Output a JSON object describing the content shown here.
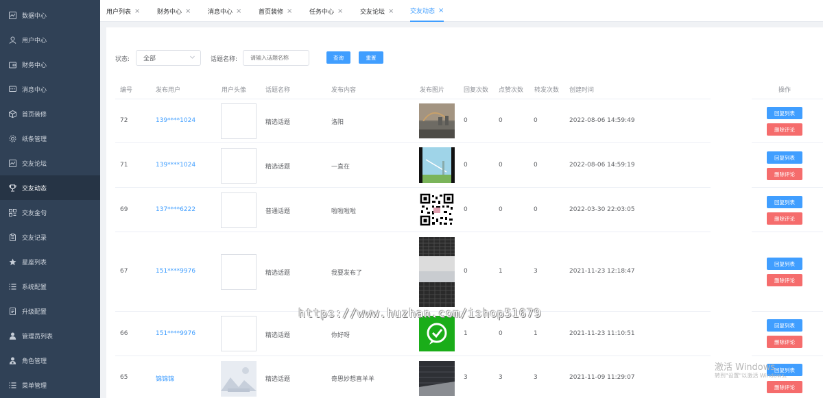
{
  "sidebar": {
    "items": [
      {
        "label": "数据中心",
        "icon": "chart-icon"
      },
      {
        "label": "用户中心",
        "icon": "user-icon"
      },
      {
        "label": "财务中心",
        "icon": "wallet-icon"
      },
      {
        "label": "消息中心",
        "icon": "message-icon"
      },
      {
        "label": "首页装修",
        "icon": "box-icon"
      },
      {
        "label": "纸条管理",
        "icon": "settings-icon"
      },
      {
        "label": "交友论坛",
        "icon": "chart-icon"
      },
      {
        "label": "交友动态",
        "icon": "trophy-icon"
      },
      {
        "label": "交友金句",
        "icon": "grid-icon"
      },
      {
        "label": "交友记录",
        "icon": "clipboard-icon"
      },
      {
        "label": "星座列表",
        "icon": "star-icon"
      },
      {
        "label": "系统配置",
        "icon": "list-icon"
      },
      {
        "label": "升级配置",
        "icon": "document-icon"
      },
      {
        "label": "管理员列表",
        "icon": "person-icon"
      },
      {
        "label": "角色管理",
        "icon": "person-badge-icon"
      },
      {
        "label": "菜单管理",
        "icon": "menu-icon"
      }
    ],
    "active_index": 7
  },
  "tabs": [
    {
      "label": "用户列表"
    },
    {
      "label": "财务中心"
    },
    {
      "label": "消息中心"
    },
    {
      "label": "首页装修"
    },
    {
      "label": "任务中心"
    },
    {
      "label": "交友论坛"
    },
    {
      "label": "交友动态"
    }
  ],
  "active_tab": 6,
  "filters": {
    "status_label": "状态:",
    "status_value": "全部",
    "topic_label": "话题名称:",
    "topic_placeholder": "请输入话题名称",
    "search_button": "查询",
    "reset_button": "重置"
  },
  "table": {
    "headers": [
      "编号",
      "发布用户",
      "用户头像",
      "话题名称",
      "发布内容",
      "发布图片",
      "回复次数",
      "点赞次数",
      "转发次数",
      "创建时间",
      "操作"
    ],
    "reply_list_button": "回复列表",
    "delete_comment_button": "删除评论",
    "rows": [
      {
        "id": "72",
        "user": "139****1024",
        "topic": "精选话题",
        "content": "洛阳",
        "replies": "0",
        "likes": "0",
        "shares": "0",
        "created": "2022-08-06 14:59:49"
      },
      {
        "id": "71",
        "user": "139****1024",
        "topic": "精选话题",
        "content": "一直在",
        "replies": "0",
        "likes": "0",
        "shares": "0",
        "created": "2022-08-06 14:59:19"
      },
      {
        "id": "69",
        "user": "137****6222",
        "topic": "普通话题",
        "content": "啦啦啦啦",
        "replies": "0",
        "likes": "0",
        "shares": "0",
        "created": "2022-03-30 22:03:05"
      },
      {
        "id": "67",
        "user": "151****9976",
        "topic": "精选话题",
        "content": "我要发布了",
        "replies": "0",
        "likes": "1",
        "shares": "3",
        "created": "2021-11-23 12:18:47"
      },
      {
        "id": "66",
        "user": "151****9976",
        "topic": "精选话题",
        "content": "你好呀",
        "replies": "1",
        "likes": "0",
        "shares": "1",
        "created": "2021-11-23 11:10:51"
      },
      {
        "id": "65",
        "user": "锦锦锦",
        "topic": "精选话题",
        "content": "奇思妙想喜羊羊",
        "replies": "3",
        "likes": "3",
        "shares": "3",
        "created": "2021-11-09 11:29:07"
      }
    ]
  },
  "watermark": "https://www.huzhan.com/ishop51679",
  "windows_activation": {
    "title": "激活 Windows",
    "subtitle": "转到\"设置\"以激活 Windows。"
  }
}
